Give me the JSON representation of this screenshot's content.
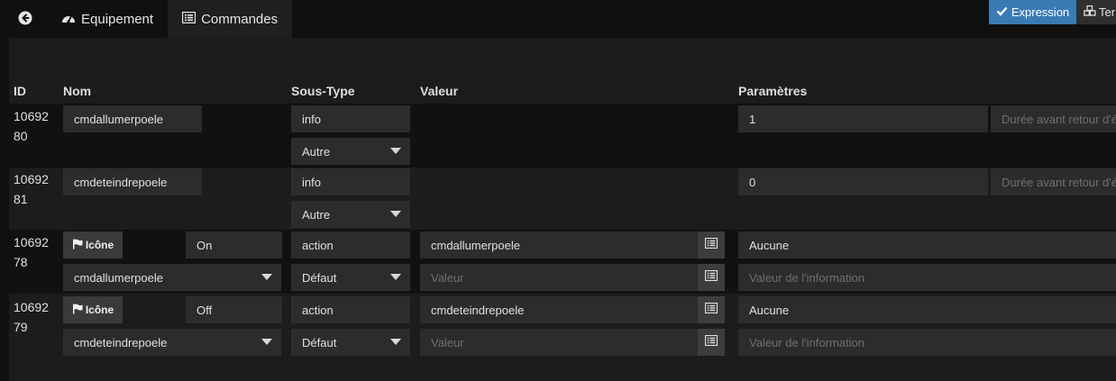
{
  "tabs": {
    "back_icon": "arrow-circle-left-icon",
    "equipement": "Equipement",
    "commandes": "Commandes"
  },
  "toolbar": {
    "expression": "Expression",
    "tem": "Ter"
  },
  "table": {
    "headers": {
      "id": "ID",
      "nom": "Nom",
      "sous_type": "Sous-Type",
      "valeur": "Valeur",
      "parametres": "Paramètres"
    },
    "rows": [
      {
        "id": "1069280",
        "id_line1": "10692",
        "id_line2": "80",
        "name": "cmdallumerpoele",
        "type": "info",
        "subtype": "Autre",
        "param_value": "1",
        "param_placeholder": "Durée avant retour d'é"
      },
      {
        "id": "1069281",
        "id_line1": "10692",
        "id_line2": "81",
        "name": "cmdeteindrepoele",
        "type": "info",
        "subtype": "Autre",
        "param_value": "0",
        "param_placeholder": "Durée avant retour d'é"
      },
      {
        "id": "1069278",
        "id_line1": "10692",
        "id_line2": "78",
        "icon_label": "Icône",
        "name": "On",
        "linked": "cmdallumerpoele",
        "type": "action",
        "subtype": "Défaut",
        "value": "cmdallumerpoele",
        "value_placeholder": "Valeur",
        "param": "Aucune",
        "param_placeholder": "Valeur de l'information"
      },
      {
        "id": "1069279",
        "id_line1": "10692",
        "id_line2": "79",
        "icon_label": "Icône",
        "name": "Off",
        "linked": "cmdeteindrepoele",
        "type": "action",
        "subtype": "Défaut",
        "value": "cmdeteindrepoele",
        "value_placeholder": "Valeur",
        "param": "Aucune",
        "param_placeholder": "Valeur de l'information"
      }
    ]
  },
  "colors": {
    "accent_blue": "#3a7ab5",
    "active_tab_underline": "#8bc34a",
    "background": "#101010"
  }
}
